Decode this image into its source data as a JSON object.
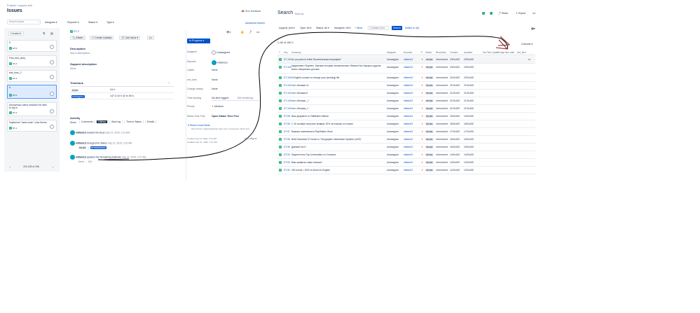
{
  "breadcrumb": {
    "projects": "Projects",
    "sep": "/",
    "project": "support_test"
  },
  "page_title": "Issues",
  "give_feedback": "Give feedback",
  "filters": {
    "search_placeholder": "Search issues",
    "assignee": "Assignee",
    "reporter": "Reporter",
    "status": "Status",
    "type": "Type",
    "advanced": "Advanced search"
  },
  "list": {
    "sort": "Created",
    "items": [
      {
        "title": "5",
        "key": "ST-5",
        "type": "story"
      },
      {
        "title": "First_test_story",
        "key": "ST-2",
        "type": "story"
      },
      {
        "title": "test_time_2",
        "key": "ST-4",
        "type": "story"
      },
      {
        "title": "6",
        "key": "ST-6",
        "type": "story"
      },
      {
        "title": "Anonymous users shouldn't be able to log in",
        "key": "ST-3",
        "type": "story"
      },
      {
        "title": "Implement \"dark mode\" color theme",
        "key": "ST-1",
        "type": "story"
      }
    ],
    "pagination": "101-106 of 106"
  },
  "detail": {
    "key": "ST-3",
    "attach": "Attach",
    "create_subtask": "Create subtask",
    "link_issue": "Link issue",
    "description_label": "Description",
    "description_placeholder": "Add a description...",
    "support_description_label": "Support description",
    "support_description_value": "None",
    "timetrack_label": "Timetrack",
    "timetrack_rows": [
      {
        "badge": "To Do",
        "value": "24 h",
        "badge_kind": "gray"
      },
      {
        "badge": "In Progress",
        "value": "147 d 10 h 42 m 50 s",
        "badge_kind": "blue"
      }
    ],
    "activity_label": "Activity",
    "show_label": "Show:",
    "activity_tabs": [
      "Comments",
      "History",
      "Work log",
      "Time in Status",
      "Emails"
    ],
    "activity_active": "History",
    "events": [
      {
        "user": "mitlam13",
        "text": "created the Issue",
        "time": "July 21, 2020, 2:31 AM"
      },
      {
        "user": "mitlam13",
        "text": "changed the Status",
        "time": "July 21, 2020, 2:32 AM",
        "from": "TO DO",
        "to": "IN PROGRESS"
      },
      {
        "user": "mitlam13",
        "text": "updated the Remaining Estimate",
        "time": "July 21, 2020, 2:37 AM",
        "extra": "None → 10d"
      }
    ]
  },
  "side": {
    "watch_count": "1",
    "status_button": "In Progress",
    "fields": [
      {
        "label": "Assignee",
        "value": "Unassigned"
      },
      {
        "label": "Reporter",
        "value": "mitlam13"
      },
      {
        "label": "Labels",
        "value": "None"
      },
      {
        "label": "text_time",
        "value": "None"
      },
      {
        "label": "Change reason",
        "value": "None"
      },
      {
        "label": "Time tracking",
        "value": "No time logged",
        "extra": "10d remaining"
      },
      {
        "label": "Priority",
        "value": "Medium"
      },
      {
        "label": "Status Time Free",
        "value": "Open Status Time Free"
      }
    ],
    "show_more": "Show 6 more fields",
    "show_more_sub": "Story Points, Original Estimate, Epic Link, Components, Sprint and...",
    "created": "Created July 21, 2020, 2:31 AM",
    "updated": "Updated July 21, 2020, 2:37 AM",
    "configure": "Configure"
  },
  "search": {
    "title": "Search",
    "save_as": "Save as",
    "share": "Share",
    "export": "Export",
    "project_filter": "support_test",
    "type_filter": "Type: All",
    "status_filter": "Status: All",
    "assignee_filter": "Assignee: All",
    "more": "+ More",
    "contains_placeholder": "Contains text",
    "search_button": "Search",
    "switch_jql": "Switch to JQL",
    "count": "1–50 of 106",
    "columns": "Columns",
    "headers": [
      "T",
      "Key",
      "Summary",
      "Assignee",
      "Reporter",
      "P",
      "Status",
      "Resolution",
      "Created",
      "Updated",
      "Due",
      "Time Spent",
      "Change item date",
      "text_time"
    ],
    "rows": [
      [
        "ST-104",
        "Do you plan to finish Политическая география?",
        "Unassigned",
        "mitlam13",
        "TO DO",
        "Unresolved",
        "23/Oct/20",
        "23/Oct/20"
      ],
      [
        "ST-103",
        "Аудиокнига «Sapiens. Краткая история человечества» Юваля Ноя Харари и другие книги специально для вас",
        "Unassigned",
        "mitlam13",
        "TO DO",
        "Unresolved",
        "23/Oct/20",
        "23/Oct/20"
      ],
      [
        "ST-104",
        "5 English courses to change your (working) life",
        "Unassigned",
        "mitlam13",
        "TO DO",
        "Unresolved",
        "22/Oct/20",
        "22/Oct/20"
      ],
      [
        "ST-101",
        "тест обложка 11",
        "Unassigned",
        "mitlam13",
        "TO DO",
        "Unresolved",
        "21/Oct/20",
        "21/Oct/20"
      ],
      [
        "ST-101",
        "тест обложка 8",
        "Unassigned",
        "mitlam13",
        "TO DO",
        "Unresolved",
        "21/Oct/20",
        "21/Oct/20"
      ],
      [
        "ST-100",
        "тест обложка _7",
        "Unassigned",
        "mitlam13",
        "TO DO",
        "Unresolved",
        "21/Oct/20",
        "21/Oct/20"
      ],
      [
        "ST-100",
        "тест обложка_1",
        "Unassigned",
        "mitlam13",
        "TO DO",
        "Unresolved",
        "21/Oct/20",
        "21/Oct/20"
      ],
      [
        "ST-96",
        "Ваш Документ от Raiffeisen Mamia",
        "Unassigned",
        "mitlam13",
        "TO DO",
        "Unresolved",
        "19/Oct/20",
        "19/Oct/20"
      ],
      [
        "ST-96",
        "С 15 октября получите возврат 20% за покупку по стране",
        "Unassigned",
        "mitlam13",
        "TO DO",
        "Unresolved",
        "18/Oct/20",
        "18/Oct/20"
      ],
      [
        "ST-97",
        "Важные изменения в PlayStation Store",
        "Unassigned",
        "mitlam13",
        "TO DO",
        "Unresolved",
        "17/Oct/20",
        "17/Oct/20"
      ],
      [
        "ST-96",
        "Bulk Download 37 books in \"Geographic Information Systems (GIS)\"",
        "Unassigned",
        "mitlam13",
        "TO DO",
        "Unresolved",
        "16/Oct/20",
        "16/Oct/20"
      ],
      [
        "ST-95",
        "Дивный тест?",
        "Unassigned",
        "mitlam13",
        "TO DO",
        "Unresolved",
        "15/Oct/20",
        "15/Oct/20"
      ],
      [
        "ST-94",
        "Degrees from Top Universities on Coursera",
        "Unassigned",
        "mitlam13",
        "TO DO",
        "Unresolved",
        "14/Oct/20",
        "14/Oct/20"
      ],
      [
        "ST-93",
        "Вам нравятся наши письма?",
        "Unassigned",
        "mitlam13",
        "TO DO",
        "Unresolved",
        "13/Oct/20",
        "13/Oct/20"
      ],
      [
        "ST-92",
        "300 words = 50% of all text in English",
        "Unassigned",
        "mitlam13",
        "TO DO",
        "Unresolved",
        "12/Oct/20",
        "12/Oct/20"
      ]
    ]
  },
  "colors": {
    "accent": "#0052cc",
    "story": "#36b37e",
    "annotation": "#000000",
    "selected": "#deebff"
  }
}
